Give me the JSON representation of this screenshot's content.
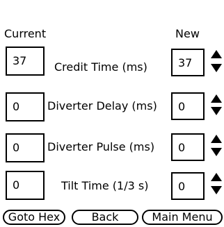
{
  "headers": {
    "current": "Current",
    "new": "New"
  },
  "rows": [
    {
      "label": "Credit Time (ms)",
      "current": "37",
      "new": "37"
    },
    {
      "label": "Diverter Delay (ms)",
      "current": "0",
      "new": "0"
    },
    {
      "label": "Diverter Pulse (ms)",
      "current": "0",
      "new": "0"
    },
    {
      "label": "Tilt Time (1/3 s)",
      "current": "0",
      "new": "0"
    }
  ],
  "buttons": {
    "goto_hex": "Goto Hex",
    "back": "Back",
    "main_menu": "Main Menu"
  },
  "icons": {
    "increment": "up-arrow-icon",
    "decrement": "down-arrow-icon"
  }
}
